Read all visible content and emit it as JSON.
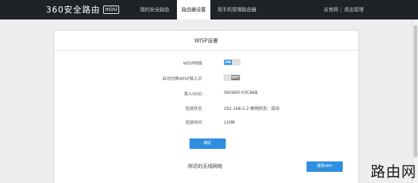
{
  "brand": {
    "name": "360安全路由",
    "badge": "mini"
  },
  "nav": {
    "tabs": [
      {
        "label": "我的安全路由",
        "active": false
      },
      {
        "label": "路由器设置",
        "active": true
      },
      {
        "label": "用手机管理路由器",
        "active": false
      }
    ],
    "right": {
      "home_link": "去官网",
      "separator": "|",
      "logout": "退出管理"
    }
  },
  "wisp": {
    "title": "WISP设置",
    "rows": {
      "wisp_network": {
        "label": "WISP网络",
        "state": "ON"
      },
      "auto_switch": {
        "label": "自动切换WISP接入点",
        "state": "OFF"
      },
      "ssid": {
        "label": "接入SSID",
        "value": "360WiFi-F0C868"
      },
      "connection": {
        "label": "连接状态",
        "value": "192.168.5.2  联网状态：成功"
      },
      "duration": {
        "label": "连接时间",
        "value": "1分钟"
      }
    },
    "confirm_button": "确定"
  },
  "nearby": {
    "title": "附近的无线网络",
    "search_button": "搜索WiFi"
  },
  "watermark": "路由网",
  "colors": {
    "topbar": "#1f2226",
    "accent": "#2e8ee0",
    "background": "#eeeeee"
  }
}
